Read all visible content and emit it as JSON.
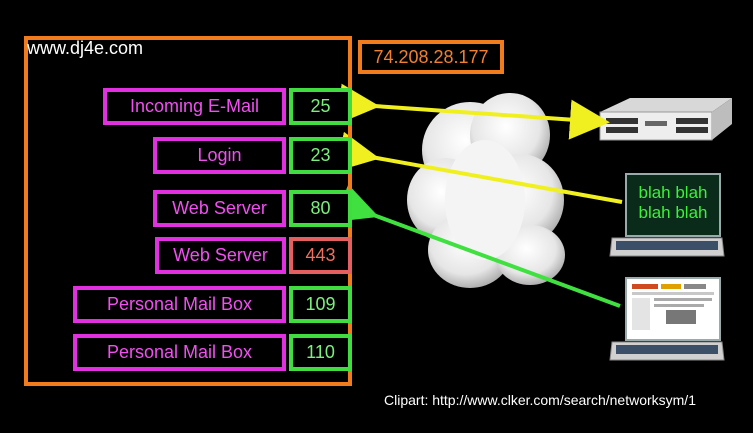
{
  "host": "www.dj4e.com",
  "ip": "74.208.28.177",
  "services": [
    {
      "label": "Incoming E-Mail",
      "port": "25"
    },
    {
      "label": "Login",
      "port": "23"
    },
    {
      "label": "Web Server",
      "port": "80"
    },
    {
      "label": "Web Server",
      "port": "443"
    },
    {
      "label": "Personal Mail Box",
      "port": "109"
    },
    {
      "label": "Personal Mail Box",
      "port": "110"
    }
  ],
  "laptop_text": [
    "blah blah",
    "blah blah"
  ],
  "credit": "Clipart: http://www.clker.com/search/networksym/1",
  "colors": {
    "server_box": "#f07c1e",
    "service": "#e030e0",
    "port": "#40dc40",
    "port_secure": "#e46060",
    "arrow_mail": "#f0f020",
    "arrow_web": "#40e040"
  },
  "icons": [
    "cloud-icon",
    "server-appliance-icon",
    "laptop-terminal-icon",
    "laptop-browser-icon"
  ]
}
